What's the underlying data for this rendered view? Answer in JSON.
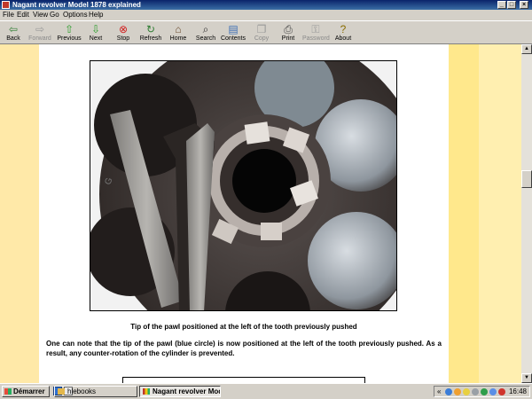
{
  "window": {
    "title": "Nagant revolver Model 1878 explained",
    "controls": {
      "minimize": "_",
      "maximize": "□",
      "close": "×"
    }
  },
  "menu": [
    "File",
    "Edit",
    "View",
    "Go",
    "Options",
    "Help"
  ],
  "toolbar": {
    "buttons": [
      {
        "label": "Back",
        "icon": "arrow-left-icon",
        "glyph": "⇦",
        "color": "#2e7d32"
      },
      {
        "label": "Forward",
        "icon": "arrow-right-icon",
        "glyph": "⇨",
        "color": "#9a9a9a",
        "disabled": true
      },
      {
        "label": "Previous",
        "icon": "arrow-up-icon",
        "glyph": "⇧",
        "color": "#2e9e2e"
      },
      {
        "label": "Next",
        "icon": "arrow-down-icon",
        "glyph": "⇩",
        "color": "#2e9e2e"
      },
      {
        "label": "Stop",
        "icon": "stop-icon",
        "glyph": "⊗",
        "color": "#d11f1f"
      },
      {
        "label": "Refresh",
        "icon": "refresh-icon",
        "glyph": "↻",
        "color": "#2e7d32"
      },
      {
        "label": "Home",
        "icon": "home-icon",
        "glyph": "⌂",
        "color": "#6d4c2f"
      },
      {
        "label": "Search",
        "icon": "search-icon",
        "glyph": "⌕",
        "color": "#333333"
      },
      {
        "label": "Contents",
        "icon": "contents-icon",
        "glyph": "▤",
        "color": "#3d6fb5"
      },
      {
        "label": "Copy",
        "icon": "copy-icon",
        "glyph": "❐",
        "color": "#9a9a9a",
        "disabled": true
      },
      {
        "label": "Print",
        "icon": "print-icon",
        "glyph": "⎙",
        "color": "#444444"
      },
      {
        "label": "Password",
        "icon": "key-icon",
        "glyph": "⚿",
        "color": "#9a9a9a",
        "disabled": true
      },
      {
        "label": "About",
        "icon": "help-icon",
        "glyph": "?",
        "color": "#8a6d00"
      }
    ]
  },
  "content": {
    "caption": "Tip of the pawl positioned at the left of the tooth previously pushed",
    "paragraph": "One can note that the tip of the pawl (blue circle) is now positioned at the left of the tooth previously pushed. As a result, any counter-rotation of the cylinder is prevented."
  },
  "colors": {
    "left_bar": "#ffe9a8",
    "right_bar_1": "#ffe88c",
    "right_bar_2": "#ffefb0"
  },
  "taskbar": {
    "start_label": "Démarrer",
    "tasks": [
      {
        "label": "hlebooks",
        "icon": "folder-icon"
      },
      {
        "label": "Nagant revolver Model...",
        "icon": "ebook-icon",
        "active": true
      }
    ],
    "clock": "16:48",
    "tray_expand": "«"
  }
}
